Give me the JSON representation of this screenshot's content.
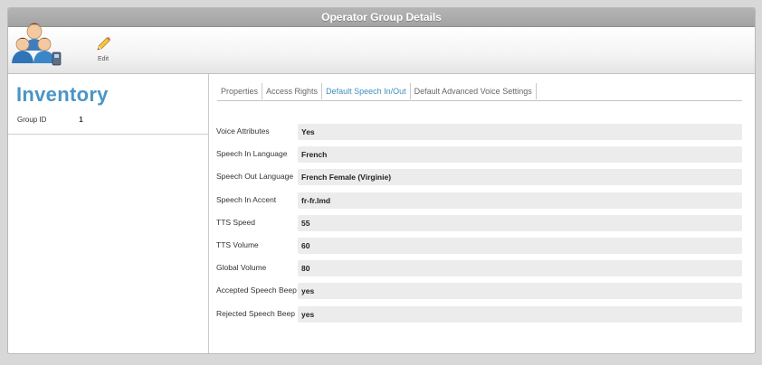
{
  "window": {
    "title": "Operator Group Details"
  },
  "toolbar": {
    "group_icon": "user-group-icon",
    "edit_icon": "pencil-icon",
    "edit_label": "Edit"
  },
  "left_panel": {
    "title": "Inventory",
    "group_id_label": "Group ID",
    "group_id_value": "1"
  },
  "tabs": [
    {
      "label": "Properties",
      "active": false
    },
    {
      "label": "Access Rights",
      "active": false
    },
    {
      "label": "Default Speech In/Out",
      "active": true
    },
    {
      "label": "Default Advanced Voice Settings",
      "active": false
    }
  ],
  "fields": [
    {
      "label": "Voice Attributes",
      "value": "Yes"
    },
    {
      "label": "Speech In Language",
      "value": "French"
    },
    {
      "label": "Speech Out Language",
      "value": "French Female (Virginie)"
    },
    {
      "label": "Speech In Accent",
      "value": "fr-fr.lmd"
    },
    {
      "label": "TTS Speed",
      "value": "55"
    },
    {
      "label": "TTS Volume",
      "value": "60"
    },
    {
      "label": "Global Volume",
      "value": "80"
    },
    {
      "label": "Accepted Speech Beep",
      "value": "yes"
    },
    {
      "label": "Rejected Speech Beep",
      "value": "yes"
    }
  ],
  "colors": {
    "accent": "#4a95c4",
    "active_tab": "#3f8fc0",
    "titlebar": "#a9a9a9",
    "field_bg": "#ececec"
  }
}
